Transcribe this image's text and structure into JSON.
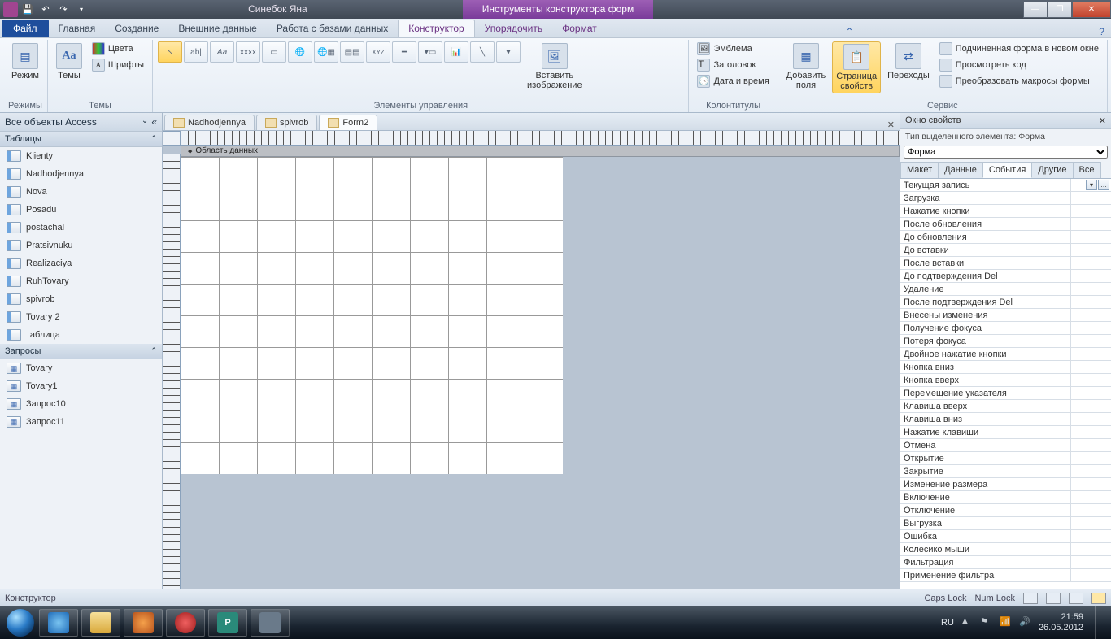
{
  "titlebar": {
    "doc_title": "Синебок Яна",
    "contextual_header": "Инструменты конструктора форм"
  },
  "ribbon": {
    "file_tab": "Файл",
    "tabs": [
      "Главная",
      "Создание",
      "Внешние данные",
      "Работа с базами данных",
      "Конструктор",
      "Упорядочить",
      "Формат"
    ],
    "active_tab_index": 4,
    "groups": {
      "modes": {
        "label": "Режимы",
        "view_btn": "Режим"
      },
      "themes": {
        "label": "Темы",
        "themes_btn": "Темы",
        "colors_btn": "Цвета",
        "fonts_btn": "Шрифты"
      },
      "controls": {
        "label": "Элементы управления",
        "insert_image": "Вставить",
        "insert_image2": "изображение"
      },
      "header_footer": {
        "label": "Колонтитулы",
        "emblem": "Эмблема",
        "title": "Заголовок",
        "date_time": "Дата и время"
      },
      "tools": {
        "label": "Сервис",
        "add_fields": "Добавить",
        "add_fields2": "поля",
        "prop_sheet": "Страница",
        "prop_sheet2": "свойств",
        "transitions": "Переходы",
        "subform": "Подчиненная форма в новом окне",
        "view_code": "Просмотреть код",
        "convert_macros": "Преобразовать макросы формы"
      }
    }
  },
  "nav": {
    "header": "Все объекты Access",
    "sections": [
      {
        "title": "Таблицы",
        "type": "table",
        "items": [
          "Klienty",
          "Nadhodjennya",
          "Nova",
          "Posadu",
          "postachal",
          "Pratsivnuku",
          "Realizaciya",
          "RuhTovary",
          "spivrob",
          "Tovary 2",
          "таблица"
        ]
      },
      {
        "title": "Запросы",
        "type": "query",
        "items": [
          "Tovary",
          "Tovary1",
          "Запрос10",
          "Запрос11"
        ]
      }
    ]
  },
  "doc_tabs": {
    "tabs": [
      "Nadhodjennya",
      "spivrob",
      "Form2"
    ],
    "active_index": 2
  },
  "section_bar": "Область данных",
  "propsheet": {
    "title": "Окно свойств",
    "subtitle_prefix": "Тип выделенного элемента:",
    "subtitle_value": "Форма",
    "selector_value": "Форма",
    "tabs": [
      "Макет",
      "Данные",
      "События",
      "Другие",
      "Все"
    ],
    "active_tab_index": 2,
    "events": [
      "Текущая запись",
      "Загрузка",
      "Нажатие кнопки",
      "После обновления",
      "До обновления",
      "До вставки",
      "После вставки",
      "До подтверждения Del",
      "Удаление",
      "После подтверждения Del",
      "Внесены изменения",
      "Получение фокуса",
      "Потеря фокуса",
      "Двойное нажатие кнопки",
      "Кнопка вниз",
      "Кнопка вверх",
      "Перемещение указателя",
      "Клавиша вверх",
      "Клавиша вниз",
      "Нажатие клавиши",
      "Отмена",
      "Открытие",
      "Закрытие",
      "Изменение размера",
      "Включение",
      "Отключение",
      "Выгрузка",
      "Ошибка",
      "Колесико мыши",
      "Фильтрация",
      "Применение фильтра"
    ]
  },
  "statusbar": {
    "mode": "Конструктор",
    "caps": "Caps Lock",
    "num": "Num Lock"
  },
  "taskbar": {
    "lang": "RU",
    "time": "21:59",
    "date": "26.05.2012"
  }
}
